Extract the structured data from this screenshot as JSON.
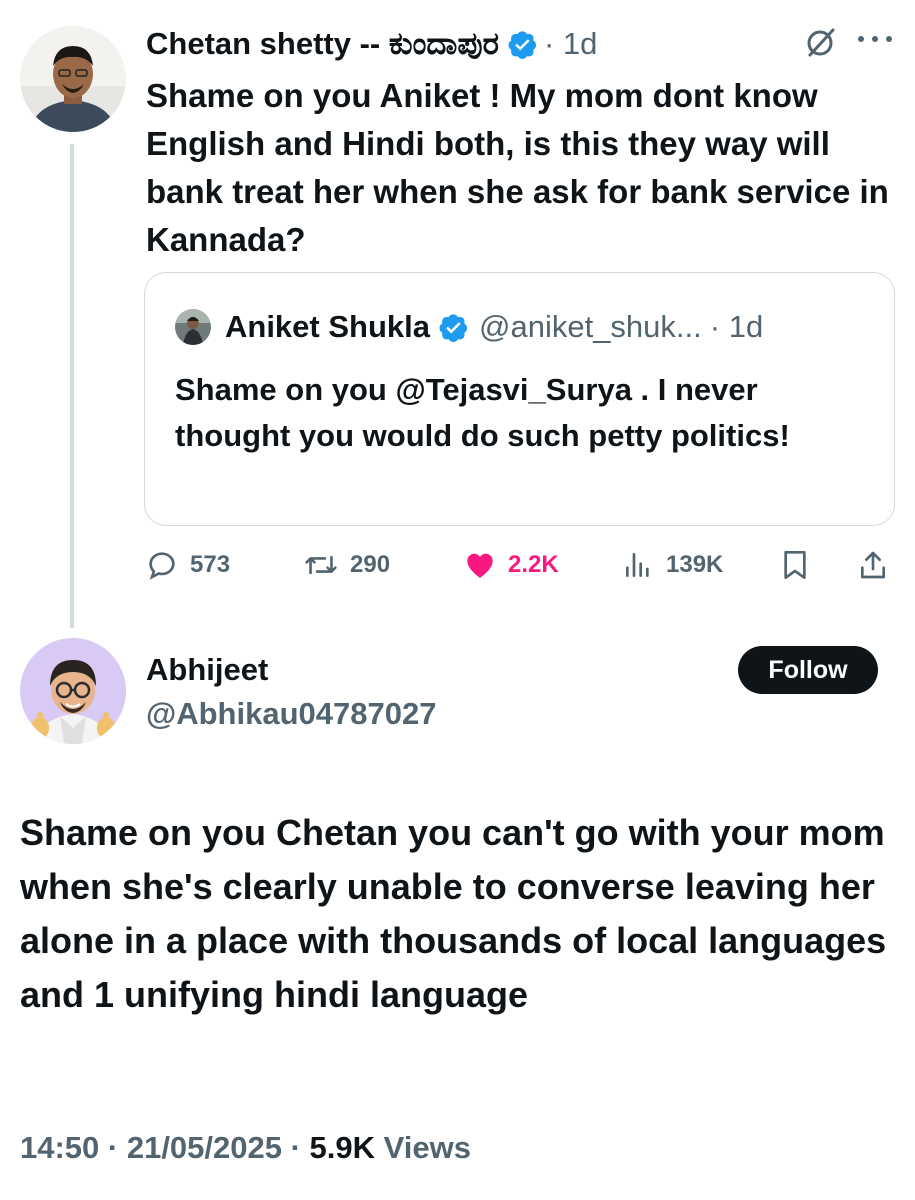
{
  "parent_tweet": {
    "author_name": "Chetan shetty -- ಕುಂದಾಪುರ",
    "separator_time": "· 1d",
    "text": "Shame on you Aniket ! My mom dont know English and Hindi both, is this they way will bank treat her when she ask for bank service in Kannada?",
    "quoted": {
      "author_name": "Aniket Shukla",
      "handle": "@aniket_shuk...",
      "time": "· 1d",
      "text": "Shame on you @Tejasvi_Surya . I never thought you would do such petty politics!"
    },
    "stats": {
      "replies": "573",
      "retweets": "290",
      "likes": "2.2K",
      "views": "139K"
    }
  },
  "reply_tweet": {
    "author_name": "Abhijeet",
    "handle": "@Abhikau04787027",
    "follow_label": "Follow",
    "text": "Shame on you Chetan you can't go with your mom when she's clearly unable to converse leaving her alone in a place with thousands of local languages and 1 unifying hindi language",
    "time": "14:50 · 21/05/2025 · ",
    "views_count": "5.9K",
    "views_label": " Views"
  },
  "colors": {
    "verified": "#1d9bf0",
    "like": "#f91880",
    "muted": "#536471",
    "border": "#cfd9de"
  },
  "icons": [
    "verified-badge-icon",
    "grok-icon",
    "more-icon",
    "reply-icon",
    "retweet-icon",
    "heart-icon",
    "views-icon",
    "bookmark-icon",
    "share-icon"
  ]
}
